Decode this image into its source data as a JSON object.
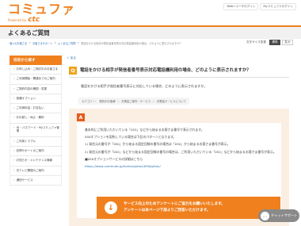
{
  "header": {
    "logo_text": "コミュファ",
    "logo_powered": "Powered by",
    "logo_brand": "ctc",
    "links": [
      "Web+ユーザログイン",
      "Myコミュファログイン"
    ]
  },
  "page_title": "よくあるご質問",
  "breadcrumbs": [
    "個人のお客さま",
    "お客さまサポート",
    "よくあるご質問",
    "電話をかける相手が発信者番号表示対応電話機利用の場合、どのように表示されますか？"
  ],
  "breadcrumb_sep": ">",
  "font_size": {
    "label": "文字サイズ変更",
    "options": [
      "標準",
      "拡大"
    ]
  },
  "sidebar": {
    "heading": "目的から探す",
    "items": [
      "お申し込み・ご検討中のお客さま",
      "ご利用開始・開通までのご案内",
      "ご契約内容の確認・変更",
      "各種オプション",
      "ご利用料金・お支払い",
      "お引越し・休止・解約",
      "ID・パスワード・Myコミュファ管理",
      "ご利用トラブル",
      "訪問サポートのご案内",
      "お知らせ・メンテナンス情報",
      "光テレビ関連のご案内",
      "通信サービス"
    ]
  },
  "main": {
    "back_label": "＜ 戻る",
    "question": "電話をかける相手が発信者番号表示対応電話機利用の場合、どのように表示されますか？",
    "q_detail1": "電話をかける相手が発信者番号表示に対応している場合、どのように表示されますか。",
    "q_detail2": "",
    "categories": [
      "カテゴリー：",
      "契約中お客様",
      "光電話ご案内・サービス",
      "光電話サービスについて"
    ],
    "answer_paragraphs": [
      "基本的にご利用いただいている「052」などから始まるお客さま番号で表示されます。",
      "050オプションを契約している場合は下記のパターンとなります。",
      "1) 発信元の番号が「050」から始まる固定回線の番号の場合は「050」から始まるお客さま番号が表示。",
      "2) 発信元の番号が「052」などから始まる固定回線の番号の場合は、ご利用いただいている「052」などから始まるお客さま番号が表示。",
      "■050オプションサービスの詳細はこちら"
    ],
    "answer_url": "https://www.commufa.jp/home/option/050option/",
    "survey_lines": [
      "サービス向上のためアンケートにご協力をお願いいたします。",
      "アンケートは本ページ下部よりご回答いただけます。"
    ]
  },
  "chat": {
    "label": "チャットサポート"
  }
}
